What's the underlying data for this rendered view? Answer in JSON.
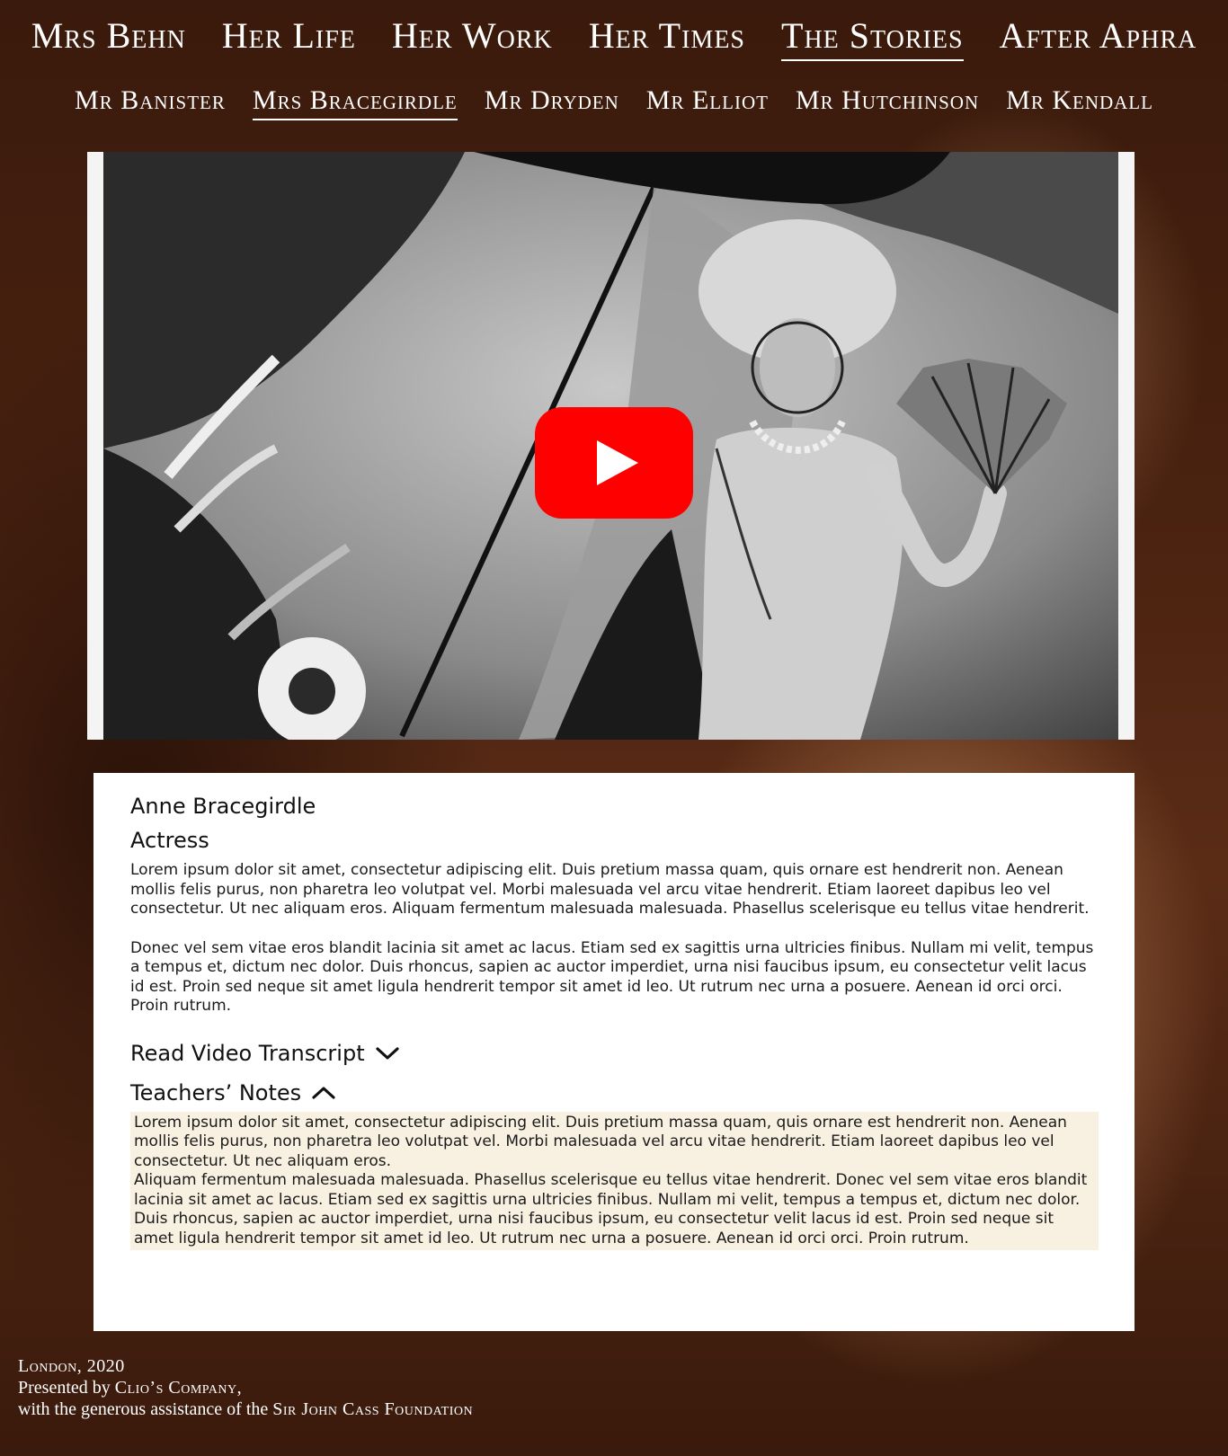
{
  "nav": {
    "primary": [
      {
        "label": "Mrs Behn"
      },
      {
        "label": "Her Life"
      },
      {
        "label": "Her Work"
      },
      {
        "label": "Her Times"
      },
      {
        "label": "The Stories"
      },
      {
        "label": "After Aphra"
      }
    ],
    "secondary": [
      {
        "label": "Mr Banister"
      },
      {
        "label": "Mrs Bracegirdle"
      },
      {
        "label": "Mr Dryden"
      },
      {
        "label": "Mr Elliot"
      },
      {
        "label": "Mr Hutchinson"
      },
      {
        "label": "Mr Kendall"
      }
    ]
  },
  "video": {
    "play_icon": "youtube-play-icon",
    "brand_color": "#ff0000"
  },
  "profile": {
    "name": "Anne Bracegirdle",
    "role": "Actress",
    "paragraphs": [
      "Lorem ipsum dolor sit amet, consectetur adipiscing elit. Duis pretium massa quam, quis ornare est hendrerit non. Aenean mollis felis purus, non pharetra leo volutpat vel. Morbi malesuada vel arcu vitae hendrerit. Etiam laoreet dapibus leo vel consectetur. Ut nec aliquam eros. Aliquam fermentum malesuada malesuada. Phasellus scelerisque eu tellus vitae hendrerit.",
      "Donec vel sem vitae eros blandit lacinia sit amet ac lacus. Etiam sed ex sagittis urna ultricies finibus. Nullam mi velit, tempus a tempus et, dictum nec dolor. Duis rhoncus, sapien ac auctor imperdiet, urna nisi faucibus ipsum, eu consectetur velit lacus id est. Proin sed neque sit amet ligula hendrerit tempor sit amet id leo. Ut rutrum nec urna a posuere. Aenean id orci orci. Proin rutrum."
    ]
  },
  "transcript": {
    "label": "Read Video Transcript",
    "icon": "chevron-down-icon"
  },
  "teachers_notes": {
    "label": "Teachers’ Notes",
    "icon": "chevron-up-icon",
    "lines": [
      "Lorem ipsum dolor sit amet, consectetur adipiscing elit. Duis pretium massa quam, quis ornare est hendrerit non. Aenean mollis felis purus, non pharetra leo volutpat vel. Morbi malesuada vel arcu vitae hendrerit. Etiam laoreet dapibus leo vel consectetur. Ut nec aliquam eros.",
      "Aliquam fermentum malesuada malesuada. Phasellus scelerisque eu tellus vitae hendrerit. Donec vel sem vitae eros blandit lacinia sit amet ac lacus. Etiam sed ex sagittis urna ultricies finibus. Nullam mi velit, tempus a tempus et, dictum nec dolor. Duis rhoncus, sapien ac auctor imperdiet, urna nisi faucibus ipsum, eu consectetur velit lacus id est. Proin sed neque sit amet ligula hendrerit tempor sit amet id leo. Ut rutrum nec urna a posuere. Aenean id orci orci. Proin rutrum."
    ]
  },
  "footer": {
    "line1": "London, 2020",
    "line2_prefix": "Presented by ",
    "line2_org": "Clio’s Company,",
    "line3_prefix": "with the generous assistance of the ",
    "line3_org": "Sir John Cass Foundation"
  }
}
